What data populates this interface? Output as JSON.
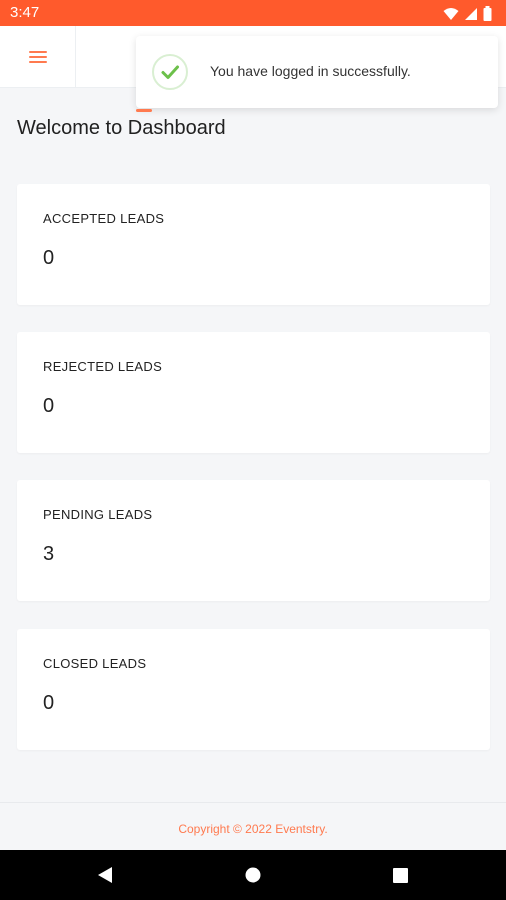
{
  "status_bar": {
    "time": "3:47",
    "icons": [
      "wifi-icon",
      "signal-icon",
      "battery-icon"
    ]
  },
  "header": {
    "menu_icon": "hamburger-menu-icon"
  },
  "toast": {
    "message": "You have logged in successfully.",
    "icon": "check-circle-icon"
  },
  "main": {
    "title": "Welcome to Dashboard",
    "cards": [
      {
        "label": "ACCEPTED LEADS",
        "value": "0"
      },
      {
        "label": "REJECTED LEADS",
        "value": "0"
      },
      {
        "label": "PENDING LEADS",
        "value": "3"
      },
      {
        "label": "CLOSED LEADS",
        "value": "0"
      }
    ]
  },
  "footer": {
    "copyright": "Copyright © 2022 Eventstry."
  },
  "nav_bar": {
    "buttons": [
      "back-icon",
      "home-icon",
      "recents-icon"
    ]
  },
  "colors": {
    "brand": "#ff5a2c",
    "accent": "#ff7a4f",
    "success": "#6cc04a",
    "background": "#f5f6f8"
  }
}
